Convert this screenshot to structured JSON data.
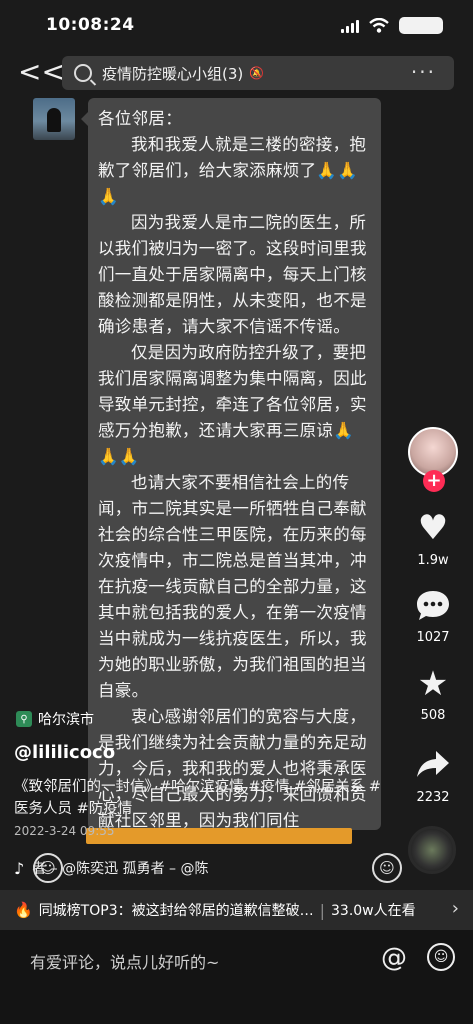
{
  "status_bar": {
    "time": "10:08:24"
  },
  "chat": {
    "back_label": "<<",
    "title": "疫情防控暖心小组(3)",
    "more_label": "···",
    "letter": {
      "greeting": "各位邻居：",
      "paragraphs": [
        "我和我爱人就是三楼的密接，抱歉了邻居们，给大家添麻烦了🙏🙏🙏",
        "因为我爱人是市二院的医生，所以我们被归为一密了。这段时间里我们一直处于居家隔离中，每天上门核酸检测都是阴性，从未变阳，也不是确诊患者，请大家不信谣不传谣。",
        "仅是因为政府防控升级了，要把我们居家隔离调整为集中隔离，因此导致单元封控，牵连了各位邻居，实感万分抱歉，还请大家再三原谅🙏🙏🙏",
        "也请大家不要相信社会上的传闻，市二院其实是一所牺牲自己奉献社会的综合性三甲医院，在历来的每次疫情中，市二院总是首当其冲，冲在抗疫一线贡献自己的全部力量，这其中就包括我的爱人，在第一次疫情当中就成为一线抗疫医生，所以，我为她的职业骄傲，为我们祖国的担当自豪。",
        "衷心感谢邻居们的宽容与大度，是我们继续为社会贡献力量的充足动力，今后，我和我的爱人也将秉承医心，尽自己最大的努力，来回馈和贡献社区邻里，因为我们同住"
      ]
    }
  },
  "video": {
    "location": "哈尔滨市",
    "author": "@lililicoco",
    "caption": "《致邻居们的一封信》#哈尔滨疫情 #疫情 #邻居关系 #医务人员 #防疫情",
    "date": "2022-3-24 09:55",
    "music": "者 – @陈奕迅    孤勇者 – @陈"
  },
  "side_actions": {
    "likes": "1.9w",
    "comments": "1027",
    "favorites": "508",
    "shares": "2232"
  },
  "hot_banner": {
    "text": "同城榜TOP3：被这封给邻居的道歉信整破…",
    "count": "33.0w人在看"
  },
  "comment_bar": {
    "placeholder": "有爱评论，说点儿好听的~"
  }
}
